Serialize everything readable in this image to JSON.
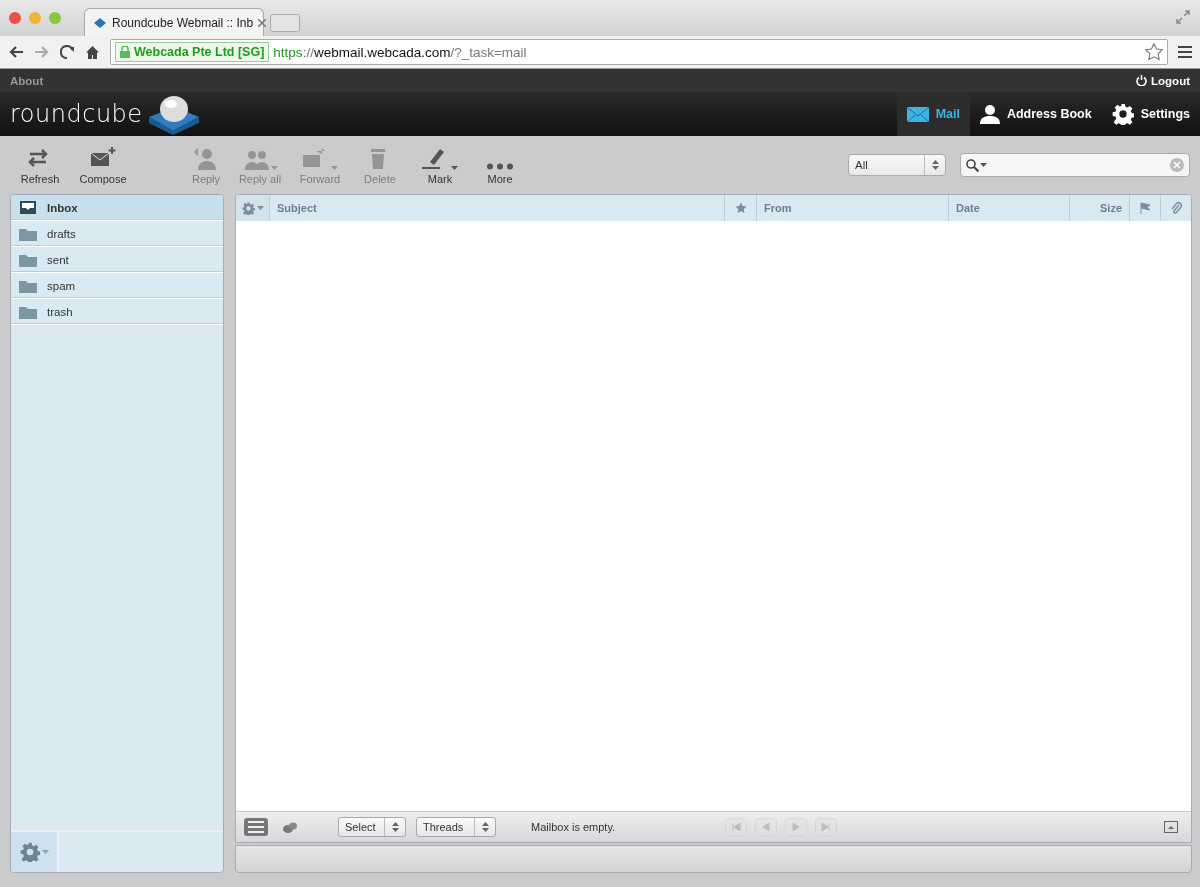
{
  "browser": {
    "tab_title": "Roundcube Webmail :: Inb",
    "identity": "Webcada Pte Ltd [SG]",
    "url": [
      {
        "kind": "scheme",
        "text": "https"
      },
      {
        "kind": "plain",
        "text": "://"
      },
      {
        "kind": "host",
        "text": "webmail.webcada.com"
      },
      {
        "kind": "plain",
        "text": "/?_task=mail"
      }
    ]
  },
  "topline": {
    "about": "About",
    "logout": "Logout"
  },
  "header": {
    "logo": "roundcube",
    "tasks": [
      {
        "kind": "mail",
        "label": "Mail",
        "selected": true
      },
      {
        "kind": "contacts",
        "label": "Address Book",
        "selected": false
      },
      {
        "kind": "settings",
        "label": "Settings",
        "selected": false
      }
    ]
  },
  "toolbar": [
    {
      "kind": "refresh",
      "label": "Refresh",
      "disabled": false,
      "dropdown": false
    },
    {
      "kind": "compose",
      "label": "Compose",
      "disabled": false,
      "dropdown": false
    },
    {
      "kind": "reply",
      "label": "Reply",
      "disabled": true,
      "dropdown": false
    },
    {
      "kind": "replyall",
      "label": "Reply all",
      "disabled": true,
      "dropdown": true
    },
    {
      "kind": "forward",
      "label": "Forward",
      "disabled": true,
      "dropdown": true
    },
    {
      "kind": "delete",
      "label": "Delete",
      "disabled": true,
      "dropdown": false
    },
    {
      "kind": "mark",
      "label": "Mark",
      "disabled": false,
      "dropdown": true
    },
    {
      "kind": "more",
      "label": "More",
      "disabled": false,
      "dropdown": false
    }
  ],
  "filter": {
    "value": "All"
  },
  "folders": [
    {
      "kind": "inbox",
      "name": "Inbox",
      "selected": true
    },
    {
      "kind": "folder",
      "name": "drafts",
      "selected": false
    },
    {
      "kind": "folder",
      "name": "sent",
      "selected": false
    },
    {
      "kind": "folder",
      "name": "spam",
      "selected": false
    },
    {
      "kind": "folder",
      "name": "trash",
      "selected": false
    }
  ],
  "columns": [
    {
      "kind": "options"
    },
    {
      "kind": "text",
      "label": "Subject"
    },
    {
      "kind": "star"
    },
    {
      "kind": "text",
      "label": "From"
    },
    {
      "kind": "text",
      "label": "Date"
    },
    {
      "kind": "size",
      "label": "Size"
    },
    {
      "kind": "flag"
    },
    {
      "kind": "attachment"
    }
  ],
  "footer": {
    "select": "Select",
    "threads": "Threads",
    "status": "Mailbox is empty.",
    "pager": [
      {
        "kind": "first",
        "disabled": true
      },
      {
        "kind": "prev",
        "disabled": true
      },
      {
        "kind": "next",
        "disabled": true
      },
      {
        "kind": "last",
        "disabled": true
      }
    ]
  }
}
